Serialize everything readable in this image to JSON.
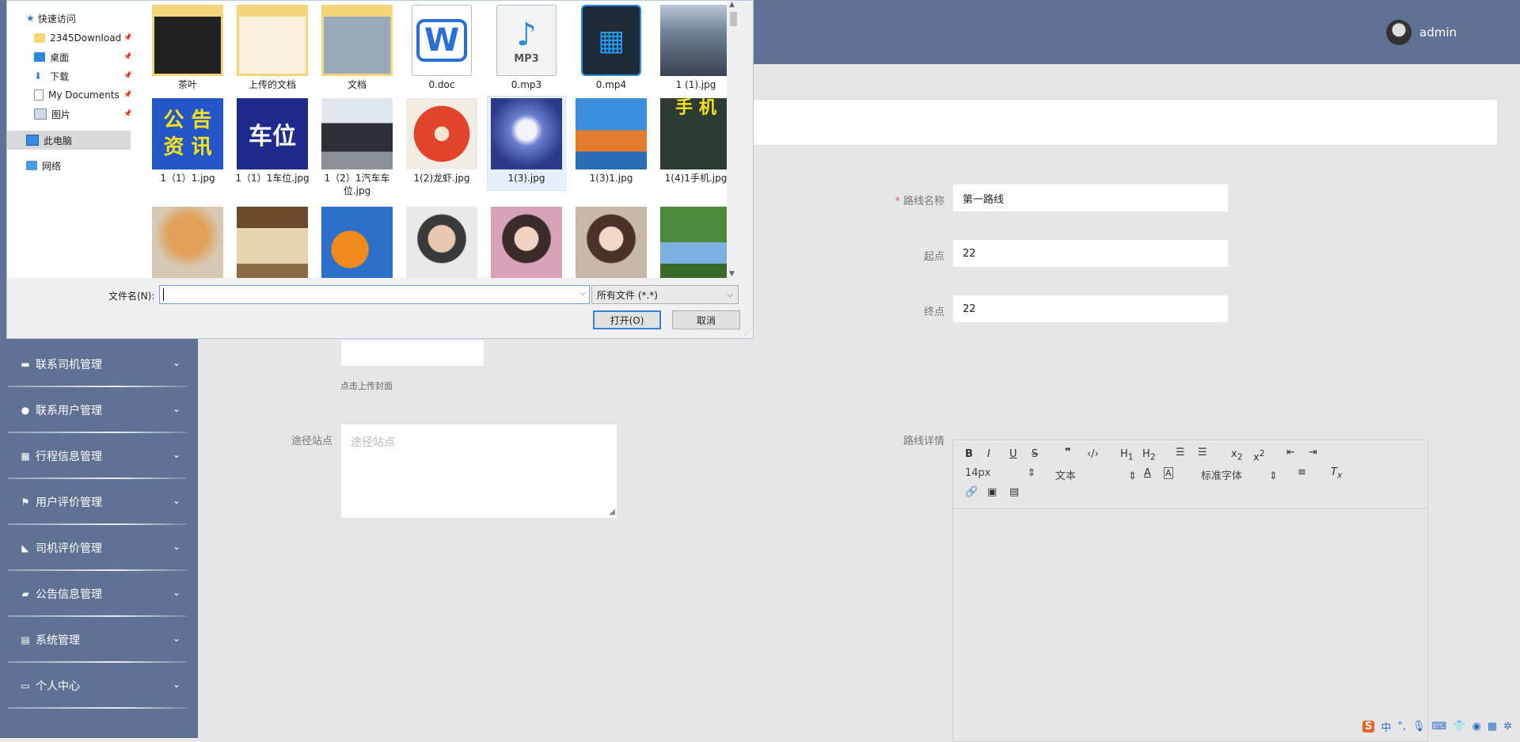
{
  "header": {
    "username": "admin"
  },
  "sidebar": {
    "items": [
      {
        "label": "联系司机管理",
        "icon": "monitor-icon"
      },
      {
        "label": "联系用户管理",
        "icon": "location-pin-icon"
      },
      {
        "label": "行程信息管理",
        "icon": "grid-icon"
      },
      {
        "label": "用户评价管理",
        "icon": "flag-icon"
      },
      {
        "label": "司机评价管理",
        "icon": "thumbs-up-icon"
      },
      {
        "label": "公告信息管理",
        "icon": "ticket-icon"
      },
      {
        "label": "系统管理",
        "icon": "clipboard-icon"
      },
      {
        "label": "个人中心",
        "icon": "card-icon"
      }
    ]
  },
  "form": {
    "route_name": {
      "label": "路线名称",
      "value": "第一路线"
    },
    "start": {
      "label": "起点",
      "value": "22"
    },
    "end": {
      "label": "终点",
      "value": "22"
    },
    "upload_hint": "点击上传封面",
    "stops": {
      "label": "途径站点",
      "placeholder": "途径站点"
    },
    "details": {
      "label": "路线详情",
      "font_size": "14px",
      "text_type": "文本",
      "font_family": "标准字体"
    }
  },
  "dialog": {
    "nav": [
      {
        "label": "快速访问",
        "icon": "star-icon"
      },
      {
        "label": "2345Download",
        "icon": "folder-icon",
        "pinned": true
      },
      {
        "label": "桌面",
        "icon": "desktop-icon",
        "pinned": true
      },
      {
        "label": "下载",
        "icon": "download-icon",
        "pinned": true
      },
      {
        "label": "My Documents",
        "icon": "document-icon",
        "pinned": true
      },
      {
        "label": "图片",
        "icon": "picture-icon",
        "pinned": true
      },
      {
        "label": "此电脑",
        "icon": "computer-icon",
        "selected": true
      },
      {
        "label": "网络",
        "icon": "network-icon"
      }
    ],
    "files": [
      {
        "name": "茶叶",
        "kind": "folder"
      },
      {
        "name": "上传的文档",
        "kind": "folder"
      },
      {
        "name": "文档",
        "kind": "folder"
      },
      {
        "name": "0.doc",
        "kind": "doc"
      },
      {
        "name": "0.mp3",
        "kind": "mp3"
      },
      {
        "name": "0.mp4",
        "kind": "mp4"
      },
      {
        "name": "1 (1).jpg",
        "kind": "image"
      },
      {
        "name": "1（1）1.jpg",
        "kind": "image",
        "thumb_text": "公 告 资 讯"
      },
      {
        "name": "1（1）1车位.jpg",
        "kind": "image",
        "thumb_text": "车位"
      },
      {
        "name": "1（2）1汽车车位.jpg",
        "kind": "image"
      },
      {
        "name": "1(2)龙虾.jpg",
        "kind": "image"
      },
      {
        "name": "1(3).jpg",
        "kind": "image",
        "selected": true
      },
      {
        "name": "1(3)1.jpg",
        "kind": "image"
      },
      {
        "name": "1(4)1手机.jpg",
        "kind": "image",
        "thumb_text": "手 机"
      },
      {
        "name": "",
        "kind": "image"
      },
      {
        "name": "",
        "kind": "image"
      },
      {
        "name": "",
        "kind": "image"
      },
      {
        "name": "",
        "kind": "image"
      },
      {
        "name": "",
        "kind": "image"
      },
      {
        "name": "",
        "kind": "image"
      },
      {
        "name": "",
        "kind": "image"
      }
    ],
    "filename_label": "文件名(N):",
    "filename_value": "",
    "filetype": "所有文件 (*.*)",
    "open_label": "打开(O)",
    "cancel_label": "取消"
  },
  "ime": {
    "brand": "S",
    "mode": "中"
  },
  "colors": {
    "chrome": "#5f7294",
    "dialog_accent": "#3c7fd8"
  }
}
